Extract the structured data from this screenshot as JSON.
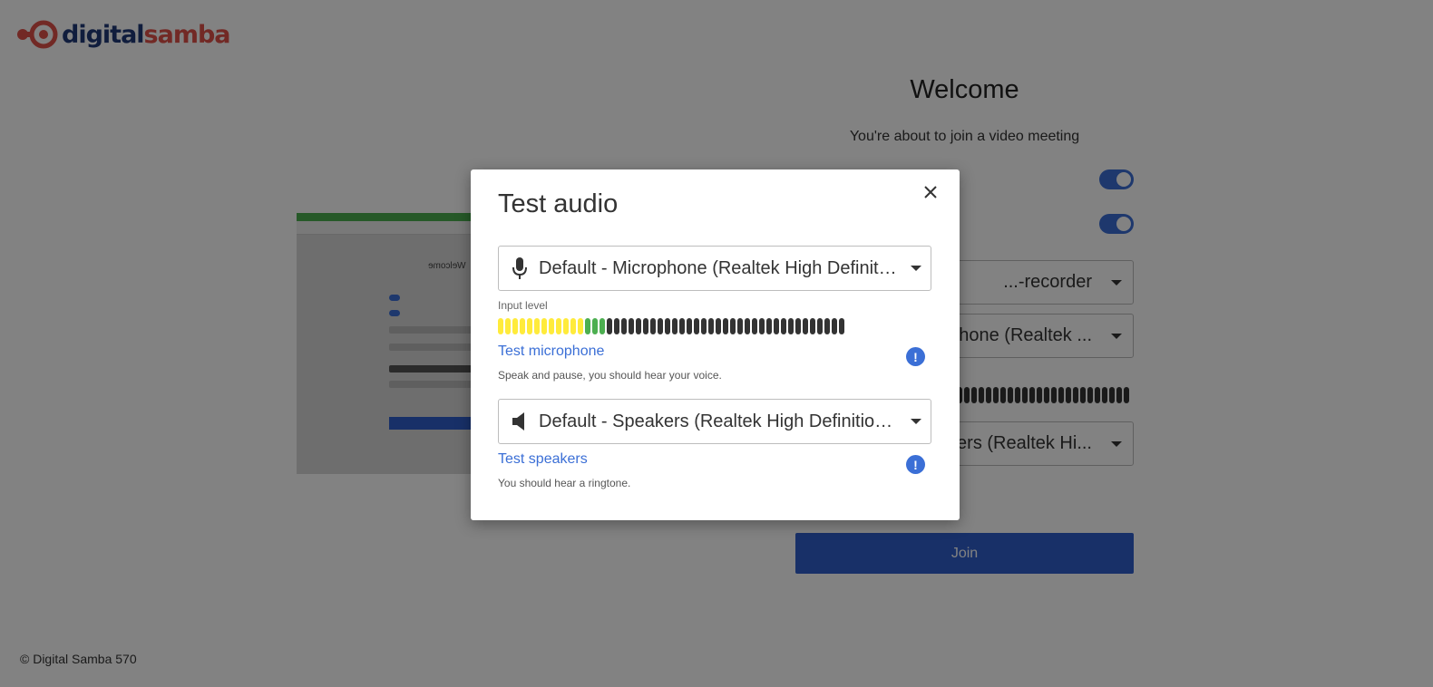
{
  "brand": {
    "part1": "digital",
    "part2": "samba",
    "color_dark": "#213a78",
    "color_red": "#e0524a"
  },
  "background": {
    "title": "Welcome",
    "subtitle": "You're about to join a video meeting",
    "select_camera": "...-recorder",
    "select_microphone": "...phone (Realtek ...",
    "select_speakers": "...ers (Realtek Hi...",
    "join_label": "Join",
    "preview_title": "Welcome",
    "toggle_color": "#3b6fd6"
  },
  "footer": {
    "copyright": "© Digital Samba 570"
  },
  "modal": {
    "title": "Test audio",
    "close_icon": "close-icon",
    "microphone_select": "Default - Microphone (Realtek High Definition Audio)",
    "input_level_label": "Input level",
    "input_level": {
      "bars_total": 48,
      "yellow_bars": 12,
      "green_bars": 3,
      "yellow": "#ffeb3b",
      "green": "#4caf50",
      "off": "#333333"
    },
    "test_microphone_link": "Test microphone",
    "test_microphone_hint": "Speak and pause, you should hear your voice.",
    "speakers_select": "Default - Speakers (Realtek High Definition Audio)",
    "test_speakers_link": "Test speakers",
    "test_speakers_hint": "You should hear a ringtone.",
    "info_icon": "exclamation-icon",
    "accent": "#3b6fd6"
  }
}
